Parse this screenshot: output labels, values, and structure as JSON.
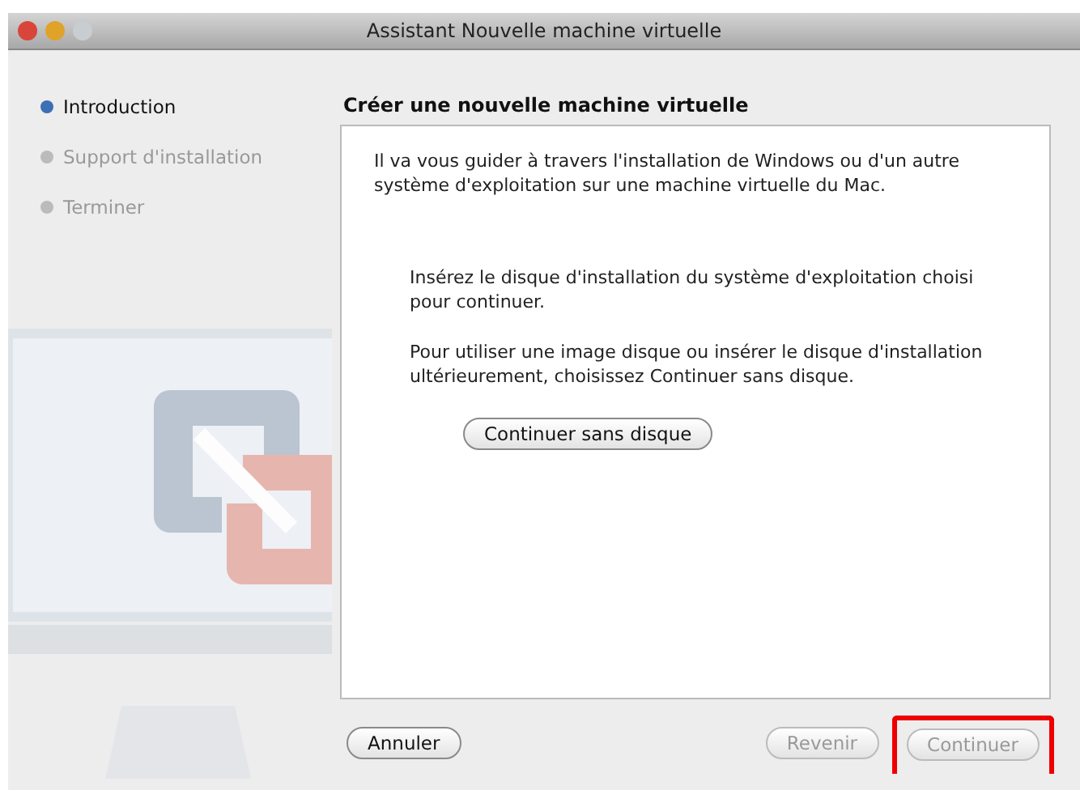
{
  "window": {
    "title": "Assistant Nouvelle machine virtuelle"
  },
  "steps": [
    {
      "label": "Introduction",
      "selected": true
    },
    {
      "label": "Support d'installation",
      "selected": false
    },
    {
      "label": "Terminer",
      "selected": false
    }
  ],
  "heading": "Créer une nouvelle machine virtuelle",
  "paragraphs": [
    "Il va vous guider à travers l'installation de Windows ou d'un autre système d'exploitation sur une machine virtuelle du Mac.",
    "Insérez le disque d'installation du système d'exploitation choisi pour continuer.",
    "Pour utiliser une image disque ou insérer le disque d'installation ultérieurement, choisissez Continuer sans disque."
  ],
  "inline_button": {
    "label": "Continuer sans disque"
  },
  "buttons": [
    {
      "label": "Annuler",
      "disabled": false,
      "highlighted": false
    },
    {
      "label": "Revenir",
      "disabled": true,
      "highlighted": false
    },
    {
      "label": "Continuer",
      "disabled": true,
      "highlighted": true
    }
  ]
}
